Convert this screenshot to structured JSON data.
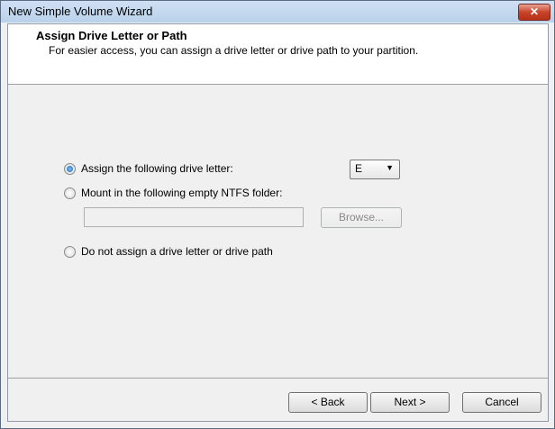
{
  "window": {
    "title": "New Simple Volume Wizard",
    "close_glyph": "✕"
  },
  "header": {
    "title": "Assign Drive Letter or Path",
    "subtitle": "For easier access, you can assign a drive letter or drive path to your partition."
  },
  "options": {
    "assign_letter": {
      "label": "Assign the following drive letter:",
      "checked": true
    },
    "mount_folder": {
      "label": "Mount in the following empty NTFS folder:",
      "checked": false
    },
    "no_assign": {
      "label": "Do not assign a drive letter or drive path",
      "checked": false
    }
  },
  "drive_letter": {
    "value": "E",
    "arrow": "▼"
  },
  "folder_path": {
    "value": ""
  },
  "browse_button": {
    "label": "Browse..."
  },
  "footer": {
    "back_label": "< Back",
    "next_label": "Next >",
    "cancel_label": "Cancel"
  },
  "icons": {
    "close": "close-icon",
    "dropdown": "chevron-down-icon"
  },
  "colors": {
    "title_bar": "#b9d1ea",
    "close_button": "#c8432b",
    "radio_selected": "#1b5fb4"
  }
}
